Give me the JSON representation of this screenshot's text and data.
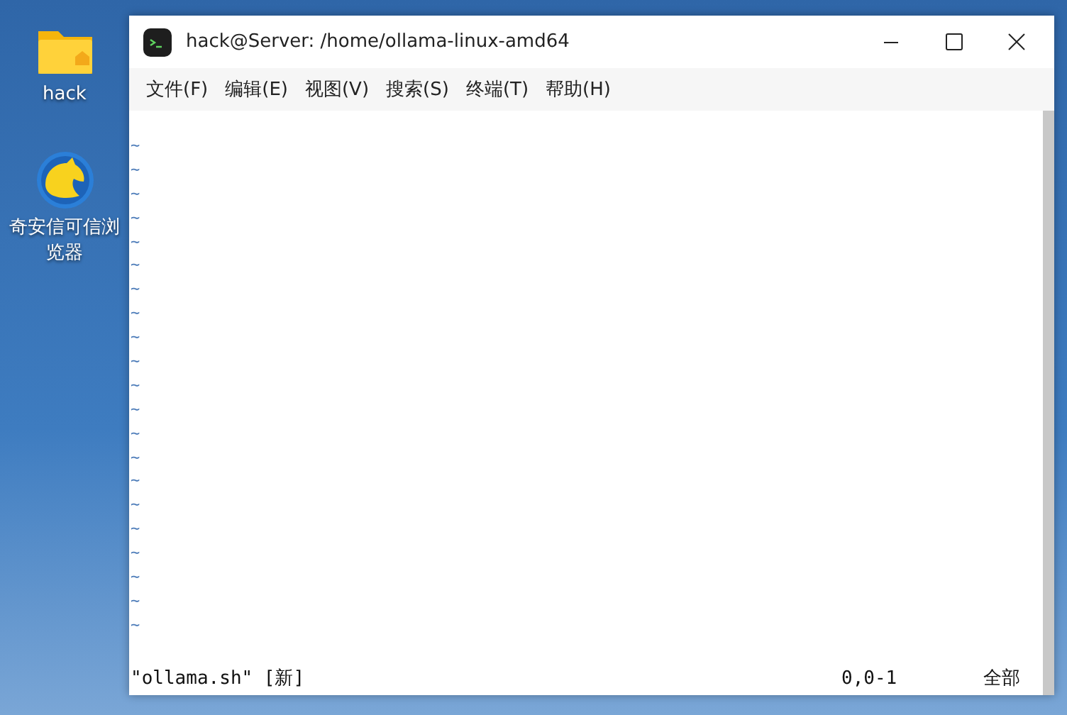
{
  "desktop_icons": [
    {
      "kind": "folder",
      "label": "hack"
    },
    {
      "kind": "browser",
      "label": "奇安信可信浏览器"
    }
  ],
  "window": {
    "title": "hack@Server: /home/ollama-linux-amd64"
  },
  "menu": [
    "文件(F)",
    "编辑(E)",
    "视图(V)",
    "搜索(S)",
    "终端(T)",
    "帮助(H)"
  ],
  "terminal": {
    "tilde_lines": [
      "~",
      "~",
      "~",
      "~",
      "~",
      "~",
      "~",
      "~",
      "~",
      "~",
      "~",
      "~",
      "~",
      "~",
      "~",
      "~",
      "~",
      "~",
      "~",
      "~",
      "~"
    ],
    "status": {
      "file": "\"ollama.sh\" [新]",
      "position": "0,0-1",
      "scroll": "全部"
    }
  }
}
